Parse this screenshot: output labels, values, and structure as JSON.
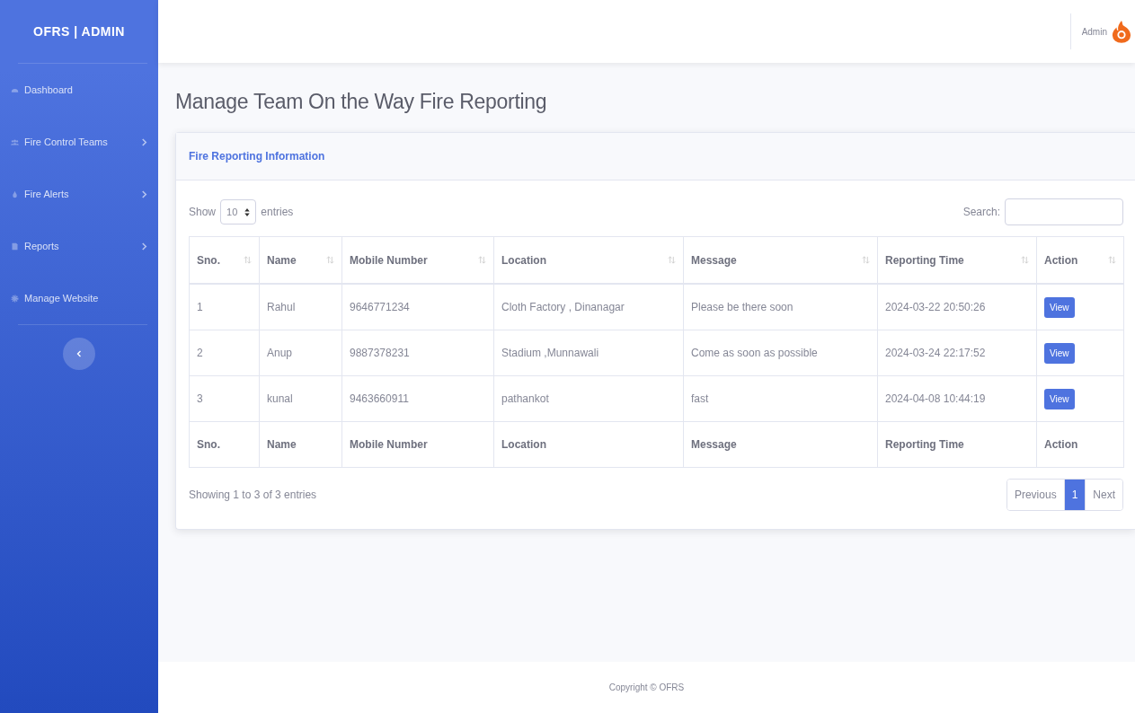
{
  "sidebar": {
    "brand": "OFRS | ADMIN",
    "items": [
      {
        "label": "Dashboard",
        "kind": "gauge",
        "has_submenu": false
      },
      {
        "label": "Fire Control Teams",
        "kind": "users",
        "has_submenu": true
      },
      {
        "label": "Fire Alerts",
        "kind": "drop",
        "has_submenu": true
      },
      {
        "label": "Reports",
        "kind": "file",
        "has_submenu": true
      },
      {
        "label": "Manage Website",
        "kind": "gear",
        "has_submenu": false
      }
    ]
  },
  "topbar": {
    "user": "Admin"
  },
  "page_title": "Manage Team On the Way Fire Reporting",
  "card": {
    "title": "Fire Reporting Information",
    "length": {
      "before": "Show",
      "value": "10",
      "after": "entries"
    },
    "search": {
      "label": "Search:"
    },
    "table": {
      "columns": [
        "Sno.",
        "Name",
        "Mobile Number",
        "Location",
        "Message",
        "Reporting Time",
        "Action"
      ],
      "rows": [
        {
          "sno": "1",
          "name": "Rahul",
          "mobile": "9646771234",
          "location": "Cloth Factory , Dinanagar",
          "message": "Please be there soon",
          "time": "2024-03-22 20:50:26",
          "action": "View"
        },
        {
          "sno": "2",
          "name": "Anup",
          "mobile": "9887378231",
          "location": "Stadium ,Munnawali",
          "message": "Come as soon as possible",
          "time": "2024-03-24 22:17:52",
          "action": "View"
        },
        {
          "sno": "3",
          "name": "kunal",
          "mobile": "9463660911",
          "location": "pathankot",
          "message": "fast",
          "time": "2024-04-08 10:44:19",
          "action": "View"
        }
      ],
      "footer_columns": [
        "Sno.",
        "Name",
        "Mobile Number",
        "Location",
        "Message",
        "Reporting Time",
        "Action"
      ]
    },
    "info": "Showing 1 to 3 of 3 entries",
    "pagination": [
      {
        "label": "Previous",
        "selected": false
      },
      {
        "label": "1",
        "selected": true
      },
      {
        "label": "Next",
        "selected": false
      }
    ]
  },
  "footer": "Copyright © OFRS"
}
